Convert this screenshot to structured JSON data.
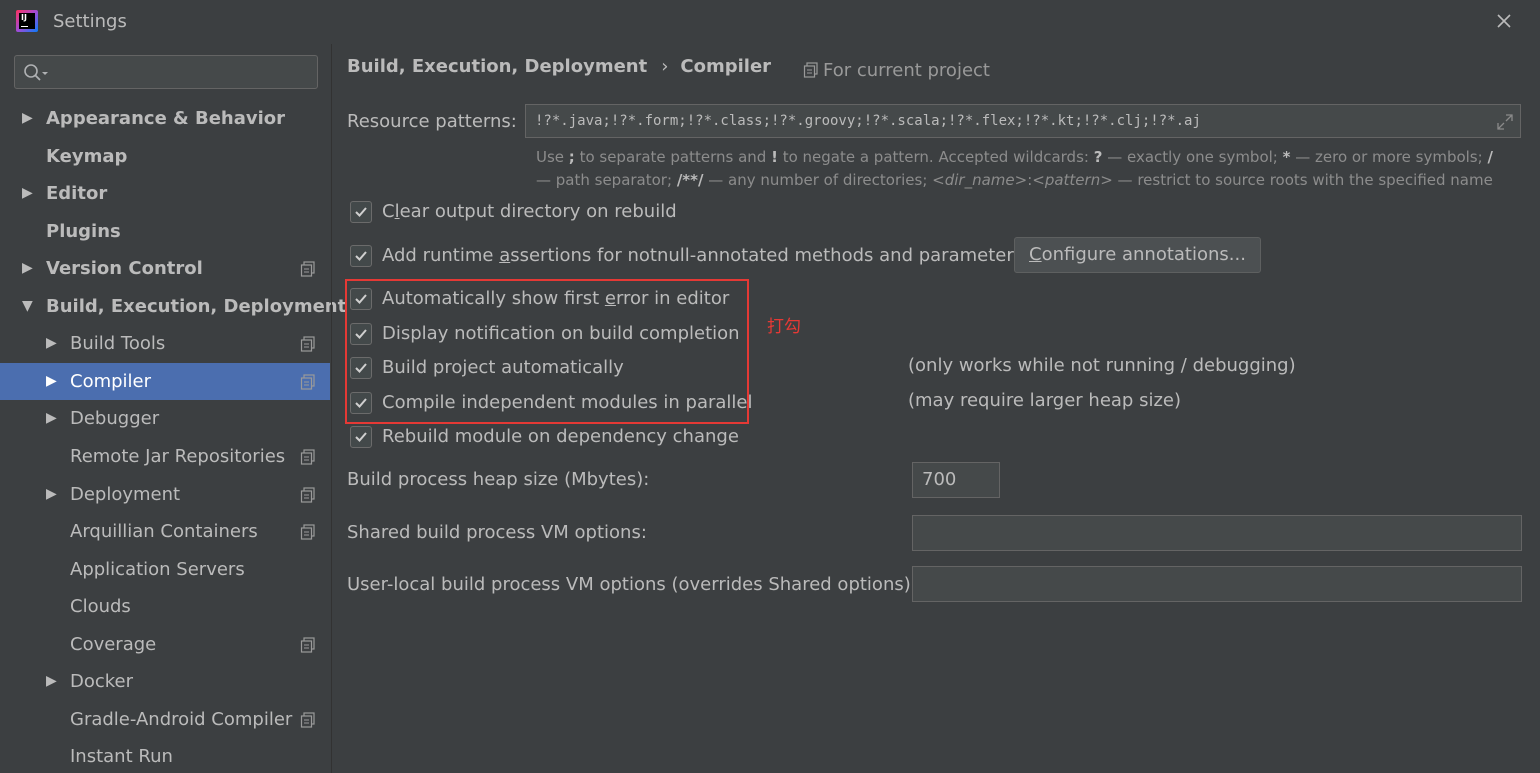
{
  "window": {
    "title": "Settings",
    "app_icon_text": "IJ"
  },
  "sidebar": {
    "search": {
      "value": "",
      "placeholder": ""
    },
    "items": [
      {
        "label": "Appearance & Behavior",
        "bold": true,
        "expandable": true,
        "expanded": false,
        "level": 0,
        "project_scope": false
      },
      {
        "label": "Keymap",
        "bold": true,
        "expandable": false,
        "level": 0,
        "project_scope": false
      },
      {
        "label": "Editor",
        "bold": true,
        "expandable": true,
        "expanded": false,
        "level": 0,
        "project_scope": false
      },
      {
        "label": "Plugins",
        "bold": true,
        "expandable": false,
        "level": 0,
        "project_scope": false
      },
      {
        "label": "Version Control",
        "bold": true,
        "expandable": true,
        "expanded": false,
        "level": 0,
        "project_scope": true
      },
      {
        "label": "Build, Execution, Deployment",
        "bold": true,
        "expandable": true,
        "expanded": true,
        "level": 0,
        "project_scope": false
      },
      {
        "label": "Build Tools",
        "bold": false,
        "expandable": true,
        "expanded": false,
        "level": 1,
        "project_scope": true
      },
      {
        "label": "Compiler",
        "bold": false,
        "expandable": true,
        "expanded": false,
        "level": 1,
        "project_scope": true,
        "selected": true
      },
      {
        "label": "Debugger",
        "bold": false,
        "expandable": true,
        "expanded": false,
        "level": 1,
        "project_scope": false
      },
      {
        "label": "Remote Jar Repositories",
        "bold": false,
        "expandable": false,
        "level": 1,
        "project_scope": true
      },
      {
        "label": "Deployment",
        "bold": false,
        "expandable": true,
        "expanded": false,
        "level": 1,
        "project_scope": true
      },
      {
        "label": "Arquillian Containers",
        "bold": false,
        "expandable": false,
        "level": 1,
        "project_scope": true
      },
      {
        "label": "Application Servers",
        "bold": false,
        "expandable": false,
        "level": 1,
        "project_scope": false
      },
      {
        "label": "Clouds",
        "bold": false,
        "expandable": false,
        "level": 1,
        "project_scope": false
      },
      {
        "label": "Coverage",
        "bold": false,
        "expandable": false,
        "level": 1,
        "project_scope": true
      },
      {
        "label": "Docker",
        "bold": false,
        "expandable": true,
        "expanded": false,
        "level": 1,
        "project_scope": false
      },
      {
        "label": "Gradle-Android Compiler",
        "bold": false,
        "expandable": false,
        "level": 1,
        "project_scope": true
      },
      {
        "label": "Instant Run",
        "bold": false,
        "expandable": false,
        "level": 1,
        "project_scope": false
      }
    ]
  },
  "main": {
    "breadcrumb": {
      "parent": "Build, Execution, Deployment",
      "separator": "›",
      "current": "Compiler"
    },
    "scope_label": "For current project",
    "resource_patterns": {
      "label": "Resource patterns:",
      "value": "!?*.java;!?*.form;!?*.class;!?*.groovy;!?*.scala;!?*.flex;!?*.kt;!?*.clj;!?*.aj"
    },
    "hint": {
      "l1_a": "Use ",
      "l1_b": ";",
      "l1_c": " to separate patterns and ",
      "l1_d": "!",
      "l1_e": " to negate a pattern. Accepted wildcards: ",
      "l1_f": "?",
      "l1_g": " — exactly one symbol; ",
      "l1_h": "*",
      "l1_i": " — zero or more symbols; ",
      "l1_j": "/",
      "l2_a": "— path separator; ",
      "l2_b": "/**/",
      "l2_c": " — any number of directories; ",
      "l2_d": "<dir_name>",
      "l2_e": ":",
      "l2_f": "<pattern>",
      "l2_g": " — restrict to source roots with the specified name"
    },
    "options": {
      "clear_output": {
        "pre": "C",
        "mnemonic": "l",
        "post": "ear output directory on rebuild",
        "checked": true
      },
      "runtime_assertions": {
        "pre": "Add runtime ",
        "mnemonic": "a",
        "post": "ssertions for notnull-annotated methods and parameters",
        "checked": true
      },
      "show_first_error": {
        "pre": "Automatically show first ",
        "mnemonic": "e",
        "post": "rror in editor",
        "checked": true
      },
      "notify_build": {
        "label": "Display notification on build completion",
        "checked": true
      },
      "build_auto": {
        "label": "Build project automatically",
        "checked": true
      },
      "compile_parallel": {
        "label": "Compile independent modules in parallel",
        "checked": true
      },
      "rebuild_dependency": {
        "label": "Rebuild module on dependency change",
        "checked": true
      }
    },
    "configure_button": {
      "mnemonic": "C",
      "post": "onfigure annotations..."
    },
    "annotation_text": "打勾",
    "notes": {
      "build_auto": "(only works while not running / debugging)",
      "compile_parallel": "(may require larger heap size)"
    },
    "heap_size": {
      "label": "Build process heap size (Mbytes):",
      "value": "700"
    },
    "shared_vm": {
      "label": "Shared build process VM options:",
      "value": ""
    },
    "user_vm": {
      "label": "User-local build process VM options (overrides Shared options):",
      "value": ""
    }
  },
  "colors": {
    "background": "#3c3f41",
    "selection": "#4b6eaf",
    "field": "#45494a",
    "text": "#bbbbbb",
    "annotation": "#e53935"
  }
}
